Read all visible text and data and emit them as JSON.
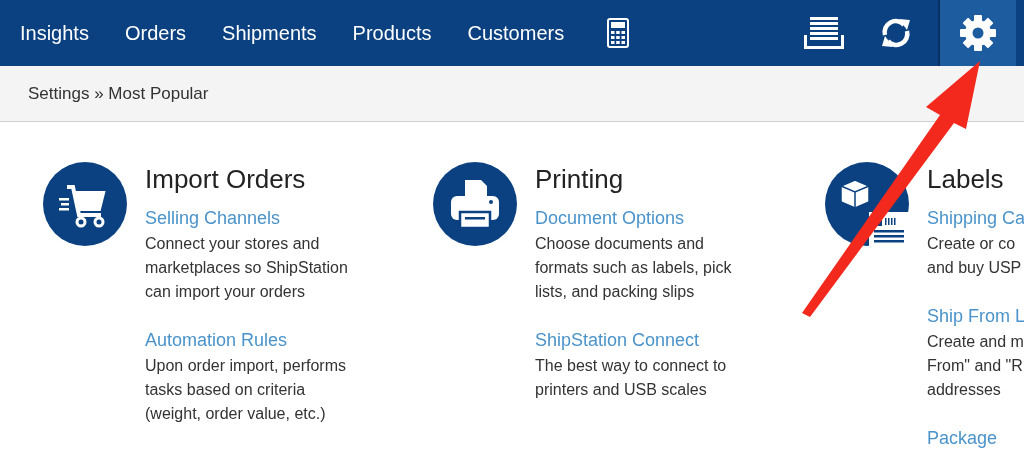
{
  "nav": {
    "items": [
      {
        "label": "Insights",
        "selected": false
      },
      {
        "label": "Orders",
        "selected": false
      },
      {
        "label": "Shipments",
        "selected": false
      },
      {
        "label": "Products",
        "selected": false
      },
      {
        "label": "Customers",
        "selected": false
      }
    ],
    "tools": [
      {
        "kind": "calculator",
        "selected": false
      },
      {
        "kind": "stack",
        "selected": false
      },
      {
        "kind": "refresh",
        "selected": false
      },
      {
        "kind": "gear",
        "selected": true
      }
    ]
  },
  "breadcrumb": "Settings » Most Popular",
  "sections": [
    {
      "kind": "cart",
      "title": "Import Orders",
      "entries": [
        {
          "link": "Selling Channels",
          "lines": [
            "Connect your stores and",
            "marketplaces so ShipStation",
            "can import your orders"
          ]
        },
        {
          "link": "Automation Rules",
          "lines": [
            "Upon order import, performs",
            "tasks based on criteria",
            "(weight, order value, etc.)"
          ]
        }
      ]
    },
    {
      "kind": "printer",
      "title": "Printing",
      "entries": [
        {
          "link": "Document Options",
          "lines": [
            "Choose documents and",
            "formats such as labels, pick",
            "lists, and packing slips"
          ]
        },
        {
          "link": "ShipStation Connect",
          "lines": [
            "The best way to connect to",
            "printers and USB scales"
          ]
        }
      ]
    },
    {
      "kind": "label",
      "title": "Labels",
      "entries": [
        {
          "link": "Shipping Ca",
          "lines": [
            "Create or co",
            "and buy USP"
          ]
        },
        {
          "link": "Ship From L",
          "lines": [
            "Create and m",
            "From\" and \"R",
            "addresses"
          ]
        },
        {
          "link": "Package"
        }
      ]
    }
  ]
}
